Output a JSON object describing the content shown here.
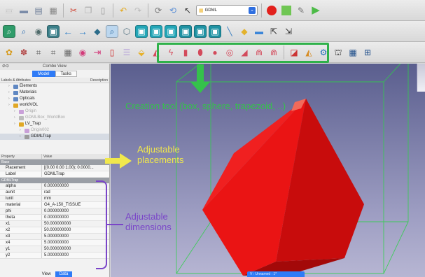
{
  "toolbar": {
    "workbench": "GDML"
  },
  "panel": {
    "title": "Combo View",
    "tabs": [
      "Model",
      "Tasks"
    ],
    "tree_header": {
      "left": "Labels & Attributes",
      "right": "Description"
    },
    "tree": [
      {
        "label": "Elements",
        "color": "#5f87c2",
        "indent": 1,
        "dim": false
      },
      {
        "label": "Materials",
        "color": "#5f87c2",
        "indent": 1,
        "dim": false
      },
      {
        "label": "Opticals",
        "color": "#5f87c2",
        "indent": 1,
        "dim": false
      },
      {
        "label": "worldVOL",
        "color": "#e0a826",
        "indent": 1,
        "dim": false
      },
      {
        "label": "Origin",
        "color": "#c9a0d8",
        "indent": 2,
        "dim": true
      },
      {
        "label": "GDMLBox_WorldBox",
        "color": "#bcbcbc",
        "indent": 2,
        "dim": true
      },
      {
        "label": "LV_Trap",
        "color": "#e0a826",
        "indent": 2,
        "dim": false
      },
      {
        "label": "Origin002",
        "color": "#c9a0d8",
        "indent": 3,
        "dim": true
      },
      {
        "label": "GDMLTrap",
        "color": "#9b9b9b",
        "indent": 3,
        "dim": false,
        "selected": true
      }
    ],
    "prop_header": {
      "left": "Property",
      "right": "Value"
    },
    "base_group": "Base",
    "base_props": [
      {
        "k": "Placement",
        "v": "[(0.00 0.00 1.00); 0.0000..."
      },
      {
        "k": "Label",
        "v": "GDMLTrap"
      }
    ],
    "trap_group": "GDMLTrap",
    "trap_props": [
      {
        "k": "alpha",
        "v": "0.000000000"
      },
      {
        "k": "aunit",
        "v": "rad"
      },
      {
        "k": "lunit",
        "v": "mm"
      },
      {
        "k": "material",
        "v": "G4_A-150_TISSUE"
      },
      {
        "k": "phi",
        "v": "0.000000000"
      },
      {
        "k": "theta",
        "v": "0.000000000"
      },
      {
        "k": "x1",
        "v": "50.000000000"
      },
      {
        "k": "x2",
        "v": "50.000000000"
      },
      {
        "k": "x3",
        "v": "5.000000000"
      },
      {
        "k": "x4",
        "v": "5.000000000"
      },
      {
        "k": "y1",
        "v": "50.000000000"
      },
      {
        "k": "y2",
        "v": "5.000000000"
      }
    ],
    "bottom_tabs": [
      "View",
      "Data"
    ]
  },
  "viewport": {
    "tab_label": "V : Unnamed : 1*"
  },
  "annotations": {
    "creation": "Creation tool (box, sphere, trapezoid, ..)",
    "placements": [
      "Adjustable",
      "placements"
    ],
    "dimensions": [
      "Adjustable",
      "dimensions"
    ]
  },
  "colors": {
    "annotation_green": "#35c14b",
    "annotation_yellow": "#f1e84c",
    "annotation_purple": "#7a45c8",
    "trapezoid_red": "#e31515",
    "selection_blue": "#2f7bf6"
  }
}
